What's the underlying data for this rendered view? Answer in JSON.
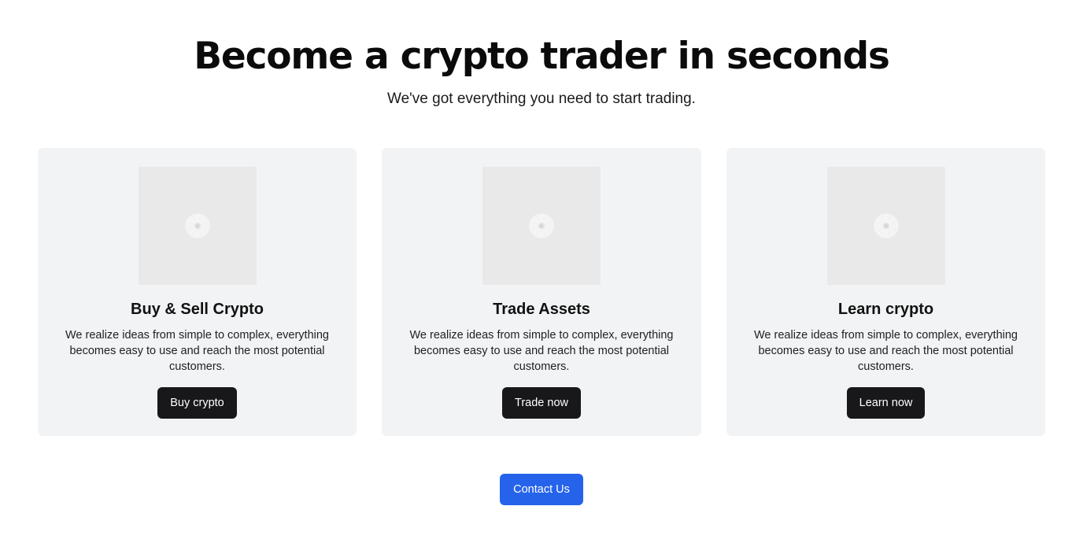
{
  "hero": {
    "title": "Become a crypto trader in seconds",
    "subtitle": "We've got everything you need to start trading."
  },
  "cards": [
    {
      "image_icon": "image-placeholder-icon",
      "title": "Buy & Sell Crypto",
      "description": "We realize ideas from simple to complex, everything becomes easy to use and reach the most potential customers.",
      "button_label": "Buy crypto"
    },
    {
      "image_icon": "image-placeholder-icon",
      "title": "Trade Assets",
      "description": "We realize ideas from simple to complex, everything becomes easy to use and reach the most potential customers.",
      "button_label": "Trade now"
    },
    {
      "image_icon": "image-placeholder-icon",
      "title": "Learn crypto",
      "description": "We realize ideas from simple to complex, everything becomes easy to use and reach the most potential customers.",
      "button_label": "Learn now"
    }
  ],
  "contact": {
    "button_label": "Contact Us"
  },
  "colors": {
    "card_background": "#f2f3f5",
    "image_placeholder": "#e9e9e9",
    "dark_button": "#18181b",
    "primary_button": "#2563eb"
  }
}
